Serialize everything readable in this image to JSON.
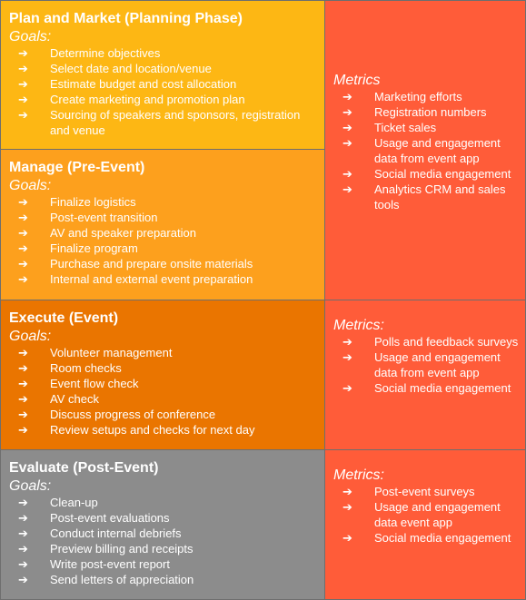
{
  "arrow_glyph": "➔",
  "colors": {
    "plan": "#FDB714",
    "manage": "#FDA01D",
    "execute": "#EA7500",
    "evaluate": "#8C8C8C",
    "metrics": "#FF5C39",
    "border": "#6E6E6E",
    "text": "#FFFFFF"
  },
  "phases": [
    {
      "title": "Plan and Market (Planning Phase)",
      "goals_label": "Goals:",
      "goals": [
        "Determine objectives",
        "Select date and location/venue",
        "Estimate budget and cost allocation",
        "Create marketing and promotion plan",
        "Sourcing of speakers and sponsors, registration and venue"
      ]
    },
    {
      "title": "Manage (Pre-Event)",
      "goals_label": "Goals:",
      "goals": [
        "Finalize logistics",
        "Post-event transition",
        "AV and speaker preparation",
        "Finalize program",
        "Purchase and prepare onsite materials",
        "Internal and external event preparation"
      ]
    },
    {
      "title": "Execute (Event)",
      "goals_label": "Goals:",
      "goals": [
        "Volunteer management",
        "Room checks",
        "Event flow check",
        "AV check",
        "Discuss progress of conference",
        "Review setups and checks for next day"
      ]
    },
    {
      "title": "Evaluate (Post-Event)",
      "goals_label": "Goals:",
      "goals": [
        "Clean-up",
        "Post-event evaluations",
        "Conduct internal debriefs",
        "Preview billing and receipts",
        "Write post-event report",
        "Send letters of appreciation"
      ]
    }
  ],
  "metrics": [
    {
      "label": "Metrics",
      "items": [
        "Marketing efforts",
        "Registration numbers",
        "Ticket sales",
        "Usage and engagement data from event app",
        "Social media engagement",
        "Analytics CRM and sales tools"
      ]
    },
    {
      "label": "Metrics:",
      "items": [
        "Polls and feedback surveys",
        "Usage and engagement data from event app",
        "Social media engagement"
      ]
    },
    {
      "label": "Metrics:",
      "items": [
        "Post-event surveys",
        "Usage and engagement data event app",
        "Social media engagement"
      ]
    }
  ]
}
